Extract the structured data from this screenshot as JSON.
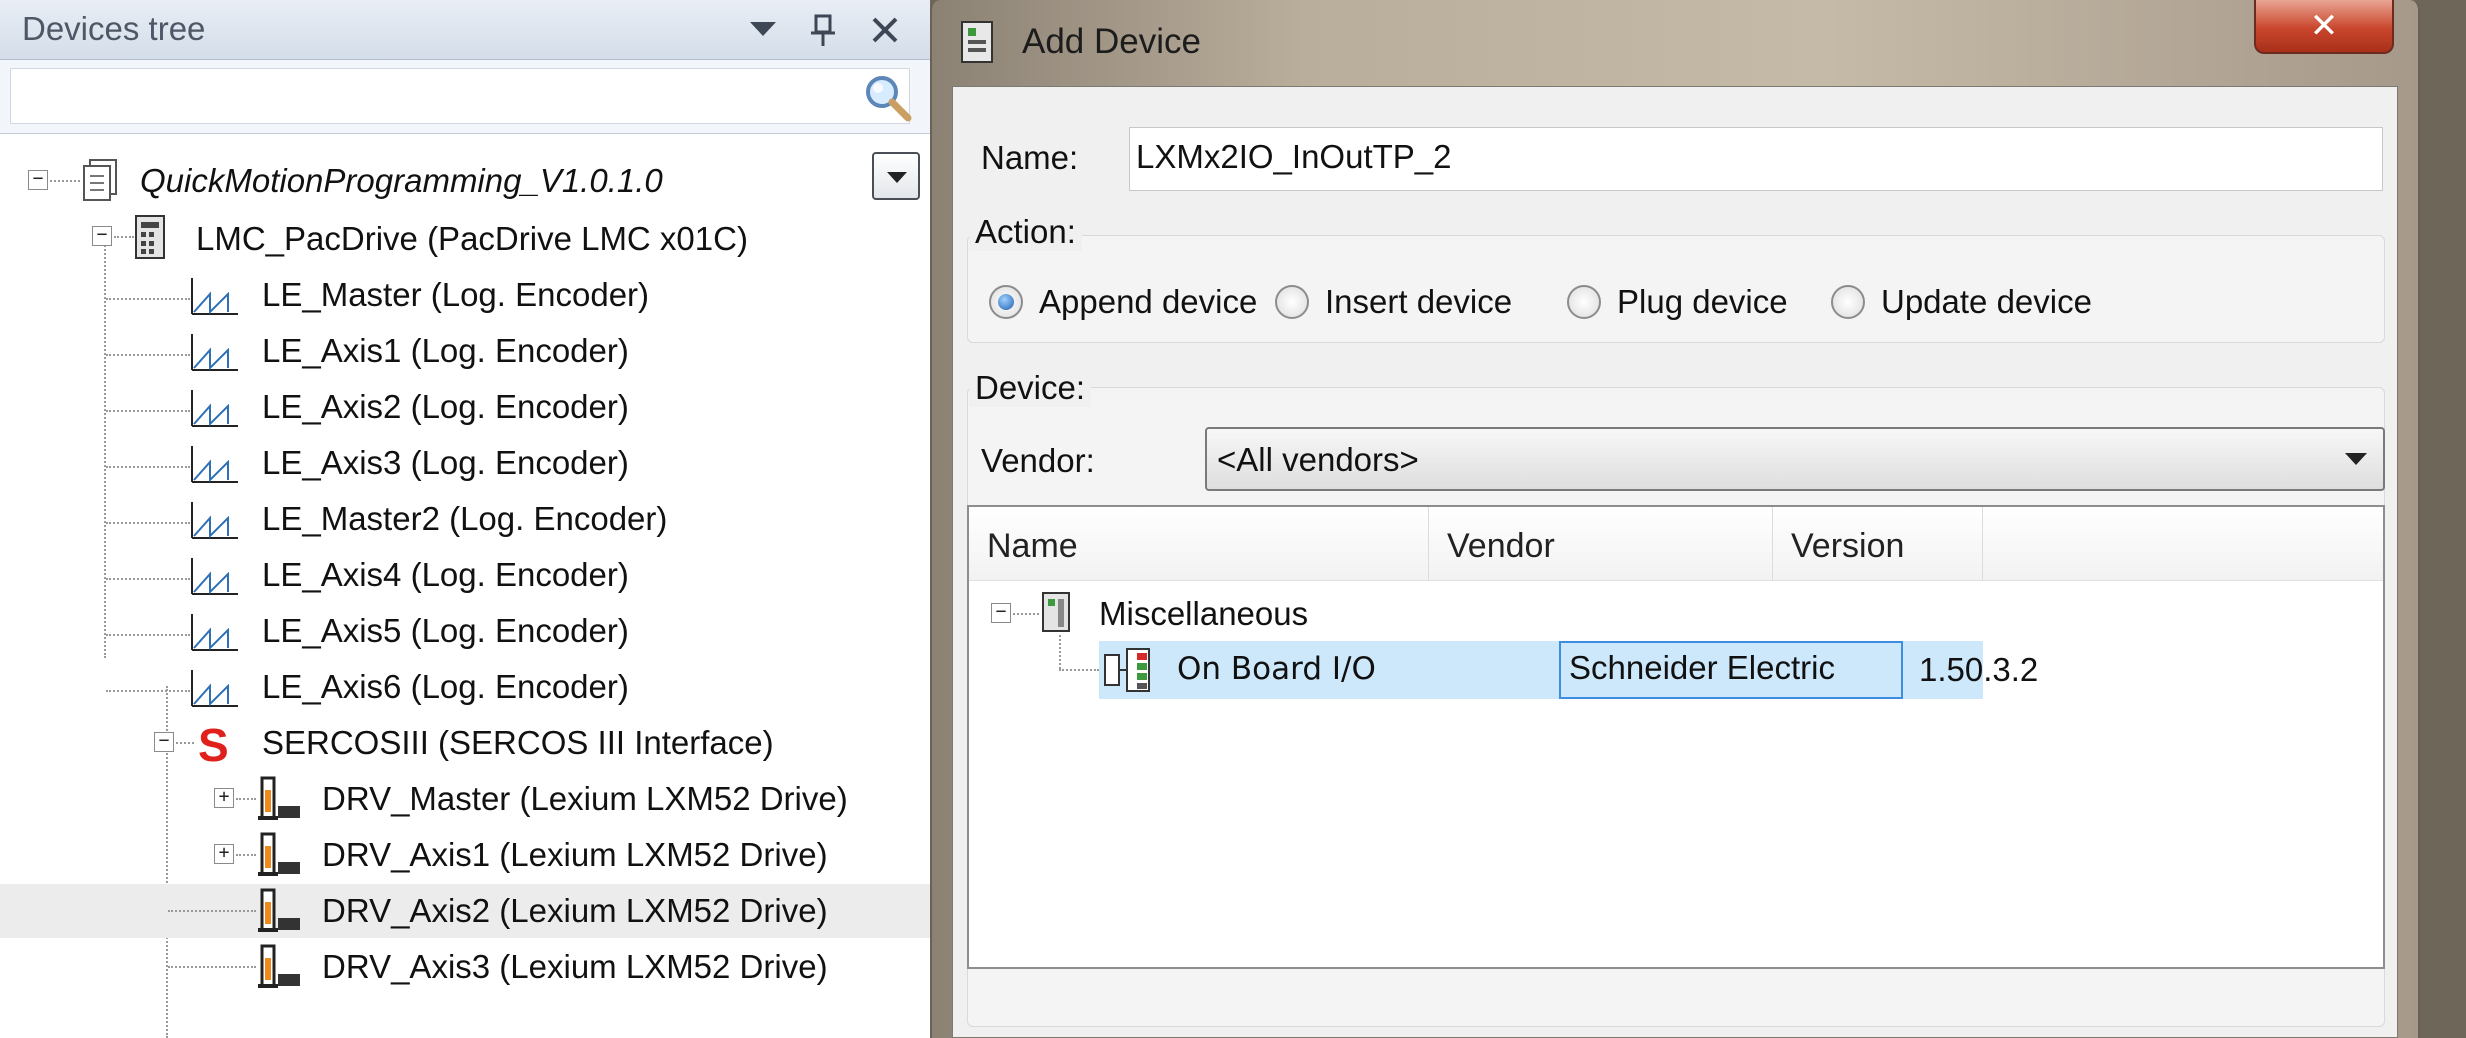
{
  "devices_tree": {
    "title": "Devices tree",
    "search_placeholder": "",
    "rows": [
      {
        "label": "QuickMotionProgramming_V1.0.1.0",
        "italic": true
      },
      {
        "label": "LMC_PacDrive (PacDrive LMC x01C)"
      },
      {
        "label": "LE_Master (Log. Encoder)"
      },
      {
        "label": "LE_Axis1 (Log. Encoder)"
      },
      {
        "label": "LE_Axis2 (Log. Encoder)"
      },
      {
        "label": "LE_Axis3 (Log. Encoder)"
      },
      {
        "label": "LE_Master2 (Log. Encoder)"
      },
      {
        "label": "LE_Axis4 (Log. Encoder)"
      },
      {
        "label": "LE_Axis5 (Log. Encoder)"
      },
      {
        "label": "LE_Axis6 (Log. Encoder)"
      },
      {
        "label": "SERCOSIII (SERCOS III Interface)"
      },
      {
        "label": "DRV_Master (Lexium LXM52 Drive)"
      },
      {
        "label": "DRV_Axis1 (Lexium LXM52 Drive)"
      },
      {
        "label": "DRV_Axis2 (Lexium LXM52 Drive)",
        "selected": true
      },
      {
        "label": "DRV_Axis3 (Lexium LXM52 Drive)"
      }
    ],
    "sercos_icon_letter": "S"
  },
  "dialog": {
    "title": "Add Device",
    "close_symbol": "✕",
    "name_label": "Name:",
    "name_value": "LXMx2IO_InOutTP_2",
    "action_label": "Action:",
    "actions": [
      {
        "label": "Append device",
        "checked": true
      },
      {
        "label": "Insert device",
        "checked": false
      },
      {
        "label": "Plug device",
        "checked": false
      },
      {
        "label": "Update device",
        "checked": false
      }
    ],
    "device_label": "Device:",
    "vendor_label": "Vendor:",
    "vendor_value": "<All vendors>",
    "list": {
      "columns": [
        "Name",
        "Vendor",
        "Version"
      ],
      "group": "Miscellaneous",
      "item": {
        "name": "On Board I/O",
        "vendor": "Schneider Electric",
        "version": "1.50.3.2"
      }
    }
  },
  "colors": {
    "selection": "#cde8fb",
    "focus_border": "#3d8ee0",
    "sercos_red": "#e0201b",
    "close_red": "#c9462c"
  }
}
